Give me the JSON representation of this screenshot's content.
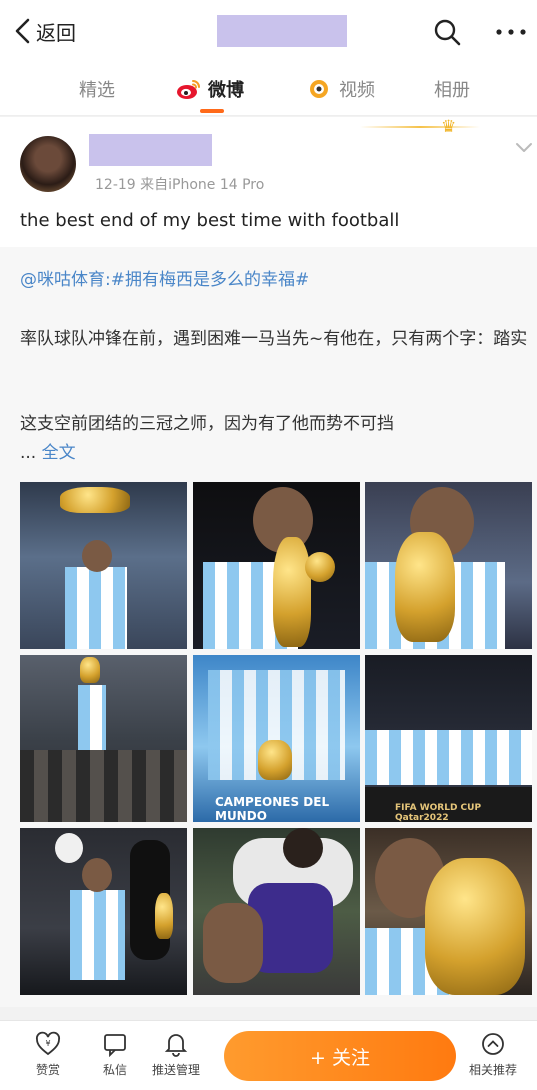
{
  "header": {
    "back_label": "返回"
  },
  "tabs": [
    {
      "label": "精选"
    },
    {
      "label": "微博"
    },
    {
      "label": "视频"
    },
    {
      "label": "相册"
    }
  ],
  "post": {
    "meta": "12-19  来自iPhone 14 Pro",
    "text": "the best end of my best time with football",
    "repost": {
      "line1": "@咪咕体育:#拥有梅西是多么的幸福#",
      "line2": "率队球队冲锋在前，遇到困难一马当先~有他在，只有两个字：踏实",
      "line3": "这支空前团结的三冠之师，因为有了他而势不可挡",
      "ellipsis": "... ",
      "more_label": "全文"
    },
    "photo_captions": {
      "campeones": "CAMPEONES DEL MUNDO",
      "worldcup": "FIFA WORLD CUP  Qatar2022"
    }
  },
  "bottom_bar": {
    "reward": "赞赏",
    "message": "私信",
    "push": "推送管理",
    "follow": "+ 关注",
    "related": "相关推荐"
  }
}
